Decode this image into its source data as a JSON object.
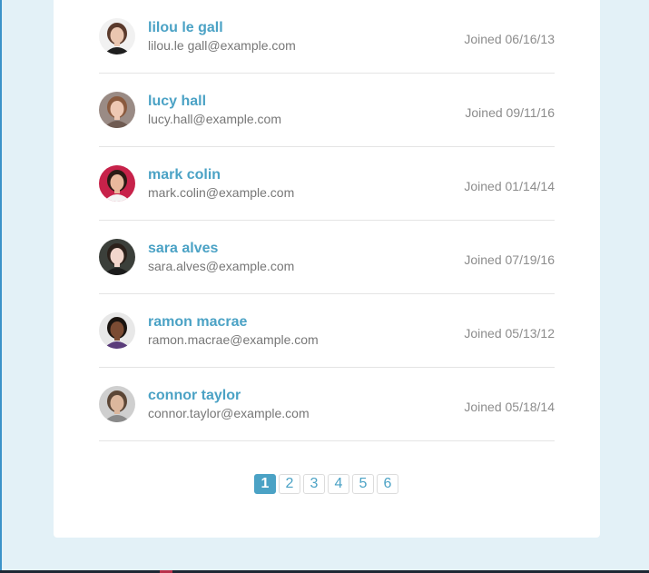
{
  "users": [
    {
      "name": "lilou le gall",
      "email": "lilou.le gall@example.com",
      "joined": "Joined 06/16/13",
      "avatar_colors": {
        "bg": "#f1f1f1",
        "hair": "#5a3a2c",
        "skin": "#eac6b0",
        "shirt": "#1f1f1f"
      }
    },
    {
      "name": "lucy hall",
      "email": "lucy.hall@example.com",
      "joined": "Joined 09/11/16",
      "avatar_colors": {
        "bg": "#9a8b85",
        "hair": "#8a5a3e",
        "skin": "#eec8b3",
        "shirt": "#6f5b52"
      }
    },
    {
      "name": "mark colin",
      "email": "mark.colin@example.com",
      "joined": "Joined 01/14/14",
      "avatar_colors": {
        "bg": "#c7224a",
        "hair": "#2a1a14",
        "skin": "#e9b89c",
        "shirt": "#f4f4f4"
      }
    },
    {
      "name": "sara alves",
      "email": "sara.alves@example.com",
      "joined": "Joined 07/19/16",
      "avatar_colors": {
        "bg": "#3b3f3a",
        "hair": "#2b201a",
        "skin": "#f2d6cc",
        "shirt": "#1c1c1c"
      }
    },
    {
      "name": "ramon macrae",
      "email": "ramon.macrae@example.com",
      "joined": "Joined 05/13/12",
      "avatar_colors": {
        "bg": "#e8e8e8",
        "hair": "#1a1410",
        "skin": "#7b4b33",
        "shirt": "#5a3c7a"
      }
    },
    {
      "name": "connor taylor",
      "email": "connor.taylor@example.com",
      "joined": "Joined 05/18/14",
      "avatar_colors": {
        "bg": "#cfcfcf",
        "hair": "#5b4636",
        "skin": "#dcb79d",
        "shirt": "#8a8a8a"
      }
    }
  ],
  "pagination": {
    "pages": [
      "1",
      "2",
      "3",
      "4",
      "5",
      "6"
    ],
    "current": "1"
  },
  "colors": {
    "accent": "#4ba2c5",
    "page_bg": "#e3f1f7",
    "card_bg": "#ffffff"
  }
}
